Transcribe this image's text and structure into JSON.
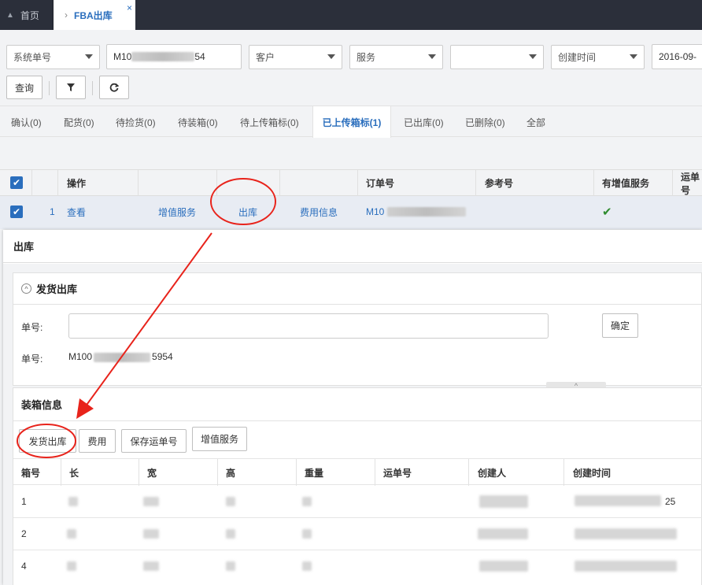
{
  "tabs": {
    "home": "首页",
    "active": "FBA出库",
    "close": "×",
    "chevron": "›"
  },
  "filters": {
    "field_select": "系统单号",
    "order_prefix": "M10",
    "order_suffix": "54",
    "customer_placeholder": "客户",
    "service_placeholder": "服务",
    "blank_select": "",
    "date_field": "创建时间",
    "date_value": "2016-09-"
  },
  "toolbar": {
    "query": "查询",
    "filter_icon": "filter-icon",
    "refresh_icon": "refresh-icon"
  },
  "status_tabs": [
    {
      "label": "确认(0)",
      "active": false
    },
    {
      "label": "配货(0)",
      "active": false
    },
    {
      "label": "待捡货(0)",
      "active": false
    },
    {
      "label": "待装箱(0)",
      "active": false
    },
    {
      "label": "待上传箱标(0)",
      "active": false
    },
    {
      "label": "已上传箱标(1)",
      "active": true
    },
    {
      "label": "已出库(0)",
      "active": false
    },
    {
      "label": "已删除(0)",
      "active": false
    },
    {
      "label": "全部",
      "active": false
    }
  ],
  "table": {
    "headers": {
      "op": "操作",
      "order": "订单号",
      "ref": "参考号",
      "vas": "有增值服务",
      "ship": "运单号"
    },
    "row": {
      "index": "1",
      "view": "查看",
      "vas_link": "增值服务",
      "outbound": "出库",
      "fee_info": "费用信息",
      "order_prefix": "M10",
      "vas_mark": "✔"
    }
  },
  "modal": {
    "title": "出库",
    "ship_panel": {
      "title": "发货出库",
      "order_label": "单号:",
      "order_input": "",
      "confirm": "确定",
      "order_label2": "单号:",
      "order_prefix": "M100",
      "order_suffix": "5954"
    },
    "box_panel": {
      "title": "装箱信息",
      "buttons": {
        "ship": "发货出库",
        "fee": "费用",
        "save_tracking": "保存运单号",
        "vas": "增值服务"
      },
      "headers": [
        "箱号",
        "长",
        "宽",
        "高",
        "重量",
        "运单号",
        "创建人",
        "创建时间"
      ],
      "rows": [
        {
          "box": "1",
          "time_tail": "25"
        },
        {
          "box": "2",
          "time_tail": ""
        },
        {
          "box": "4",
          "time_tail": ""
        }
      ]
    }
  },
  "colors": {
    "accent": "#2a6ebd",
    "annotation": "#e8231b",
    "check": "#2e8b2e",
    "topbar": "#2b2f3a"
  }
}
